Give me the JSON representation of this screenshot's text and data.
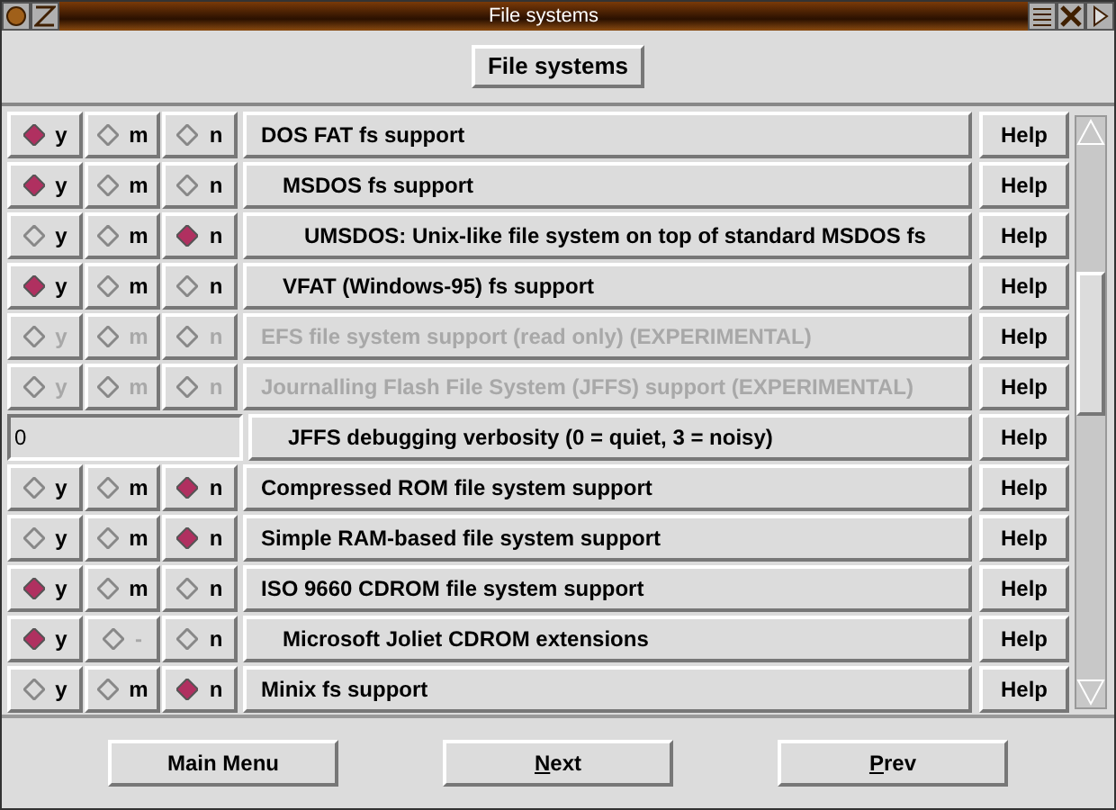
{
  "window": {
    "title": "File systems"
  },
  "header_button": "File systems",
  "options": [
    {
      "kind": "tristate",
      "label": "DOS FAT fs support",
      "disabled": false,
      "help": "Help",
      "choices": [
        {
          "label": "y",
          "selected": true,
          "disabled": false
        },
        {
          "label": "m",
          "selected": false,
          "disabled": false
        },
        {
          "label": "n",
          "selected": false,
          "disabled": false
        }
      ],
      "children": [
        {
          "kind": "tristate",
          "label": "MSDOS fs support",
          "disabled": false,
          "help": "Help",
          "choices": [
            {
              "label": "y",
              "selected": true,
              "disabled": false
            },
            {
              "label": "m",
              "selected": false,
              "disabled": false
            },
            {
              "label": "n",
              "selected": false,
              "disabled": false
            }
          ],
          "children": [
            {
              "kind": "tristate",
              "label": "UMSDOS: Unix-like file system on top of standard MSDOS fs",
              "disabled": false,
              "help": "Help",
              "choices": [
                {
                  "label": "y",
                  "selected": false,
                  "disabled": false
                },
                {
                  "label": "m",
                  "selected": false,
                  "disabled": false
                },
                {
                  "label": "n",
                  "selected": true,
                  "disabled": false
                }
              ]
            }
          ]
        },
        {
          "kind": "tristate",
          "label": "VFAT (Windows-95) fs support",
          "disabled": false,
          "help": "Help",
          "choices": [
            {
              "label": "y",
              "selected": true,
              "disabled": false
            },
            {
              "label": "m",
              "selected": false,
              "disabled": false
            },
            {
              "label": "n",
              "selected": false,
              "disabled": false
            }
          ]
        }
      ]
    },
    {
      "kind": "tristate",
      "label": "EFS file system support (read only) (EXPERIMENTAL)",
      "disabled": true,
      "help": "Help",
      "choices": [
        {
          "label": "y",
          "selected": false,
          "disabled": true
        },
        {
          "label": "m",
          "selected": false,
          "disabled": true
        },
        {
          "label": "n",
          "selected": false,
          "disabled": true
        }
      ]
    },
    {
      "kind": "tristate",
      "label": "Journalling Flash File System (JFFS) support (EXPERIMENTAL)",
      "disabled": true,
      "help": "Help",
      "choices": [
        {
          "label": "y",
          "selected": false,
          "disabled": true
        },
        {
          "label": "m",
          "selected": false,
          "disabled": true
        },
        {
          "label": "n",
          "selected": false,
          "disabled": true
        }
      ],
      "children": [
        {
          "kind": "int",
          "label": "JFFS debugging verbosity (0 = quiet, 3 = noisy)",
          "value": "0",
          "help": "Help"
        }
      ]
    },
    {
      "kind": "tristate",
      "label": "Compressed ROM file system support",
      "disabled": false,
      "help": "Help",
      "choices": [
        {
          "label": "y",
          "selected": false,
          "disabled": false
        },
        {
          "label": "m",
          "selected": false,
          "disabled": false
        },
        {
          "label": "n",
          "selected": true,
          "disabled": false
        }
      ]
    },
    {
      "kind": "tristate",
      "label": "Simple RAM-based file system support",
      "disabled": false,
      "help": "Help",
      "choices": [
        {
          "label": "y",
          "selected": false,
          "disabled": false
        },
        {
          "label": "m",
          "selected": false,
          "disabled": false
        },
        {
          "label": "n",
          "selected": true,
          "disabled": false
        }
      ]
    },
    {
      "kind": "tristate",
      "label": "ISO 9660 CDROM file system support",
      "disabled": false,
      "help": "Help",
      "choices": [
        {
          "label": "y",
          "selected": true,
          "disabled": false
        },
        {
          "label": "m",
          "selected": false,
          "disabled": false
        },
        {
          "label": "n",
          "selected": false,
          "disabled": false
        }
      ],
      "children": [
        {
          "kind": "tristate",
          "label": "Microsoft Joliet CDROM extensions",
          "disabled": false,
          "help": "Help",
          "choices": [
            {
              "label": "y",
              "selected": true,
              "disabled": false
            },
            {
              "label": "-",
              "selected": false,
              "disabled": true
            },
            {
              "label": "n",
              "selected": false,
              "disabled": false
            }
          ]
        }
      ]
    },
    {
      "kind": "tristate",
      "label": "Minix fs support",
      "disabled": false,
      "help": "Help",
      "choices": [
        {
          "label": "y",
          "selected": false,
          "disabled": false
        },
        {
          "label": "m",
          "selected": false,
          "disabled": false
        },
        {
          "label": "n",
          "selected": true,
          "disabled": false
        }
      ]
    }
  ],
  "footer_buttons": [
    {
      "rest": "Main Menu"
    },
    {
      "mnemonic": "N",
      "rest": "ext"
    },
    {
      "mnemonic": "P",
      "rest": "rev"
    }
  ]
}
